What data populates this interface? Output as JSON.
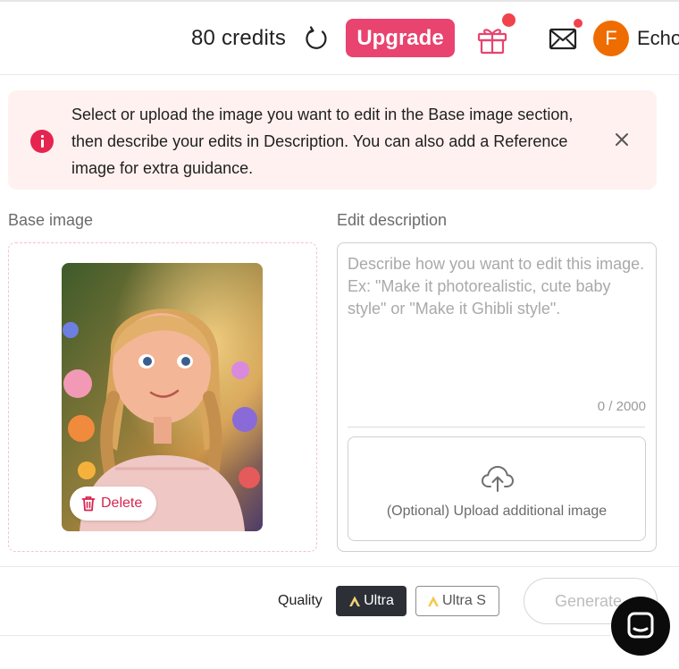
{
  "header": {
    "credits": "80 credits",
    "refresh_icon": "refresh-icon",
    "upgrade_label": "Upgrade",
    "gift_icon": "gift-icon",
    "mail_icon": "mail-icon",
    "avatar_initial": "F",
    "username": "Echo",
    "colors": {
      "upgrade": "#e9436f",
      "avatar": "#ef6c00",
      "badge": "#f0434d"
    }
  },
  "alert": {
    "icon": "info-icon",
    "text": "Select or upload the image you want to edit in the Base image section, then describe your edits in Description. You can also add a Reference image for extra guidance.",
    "close_icon": "close-icon"
  },
  "base_image": {
    "label": "Base image",
    "delete_label": "Delete"
  },
  "edit": {
    "label": "Edit description",
    "placeholder": "Describe how you want to edit this image. Ex: \"Make it photorealistic, cute baby style\" or \"Make it Ghibli style\".",
    "value": "",
    "counter": "0 / 2000",
    "upload_label": "(Optional) Upload additional image"
  },
  "footer": {
    "quality_label": "Quality",
    "options": [
      {
        "label": "Ultra",
        "selected": true
      },
      {
        "label": "Ultra S",
        "selected": false
      }
    ],
    "generate_label": "Generate",
    "chat_icon": "chat-icon"
  }
}
